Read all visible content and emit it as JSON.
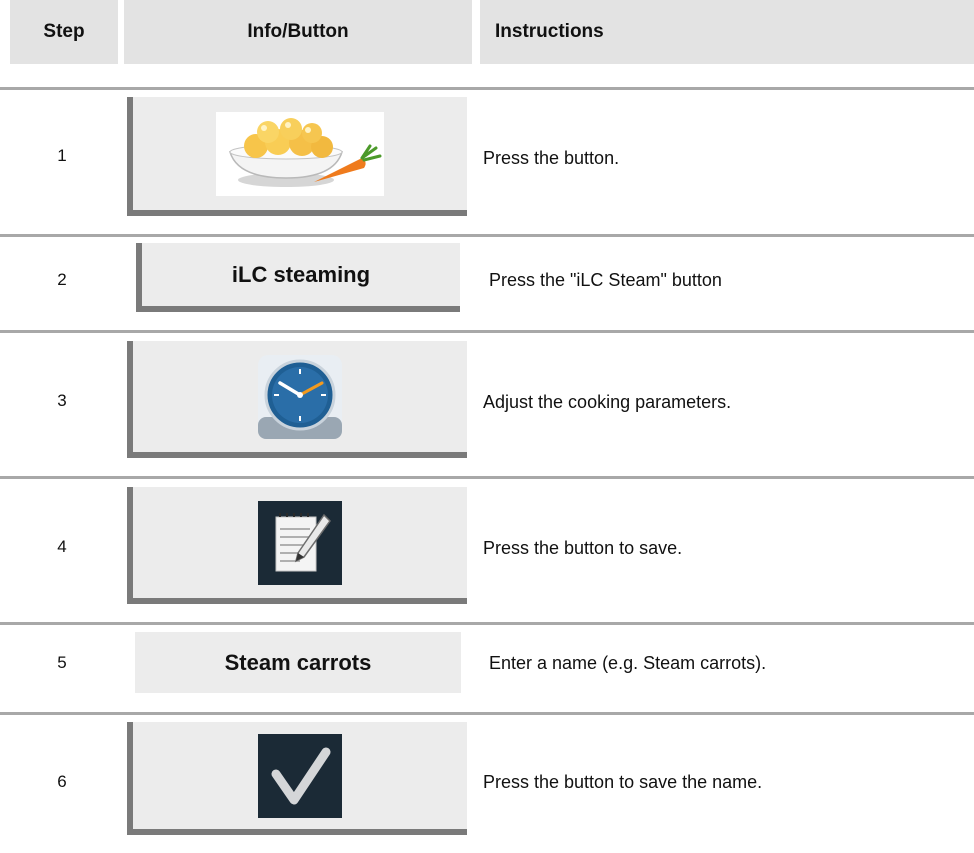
{
  "header": {
    "step": "Step",
    "info_button": "Info/Button",
    "instructions": "Instructions"
  },
  "steps": [
    {
      "number": "1",
      "icon": "dumplings-carrot-icon",
      "instruction": "Press the button."
    },
    {
      "number": "2",
      "button_label": "iLC steaming",
      "instruction": "Press the \"iLC Steam\" button"
    },
    {
      "number": "3",
      "icon": "clock-icon",
      "instruction": "Adjust the cooking parameters."
    },
    {
      "number": "4",
      "icon": "notepad-pencil-icon",
      "instruction": "Press the button to save."
    },
    {
      "number": "5",
      "button_label": "Steam carrots",
      "instruction": "Enter a name (e.g. Steam carrots)."
    },
    {
      "number": "6",
      "icon": "checkmark-icon",
      "instruction": "Press the button to save the name."
    }
  ],
  "colors": {
    "header_bg": "#e3e3e3",
    "divider": "#a8a8a8",
    "button_bg": "#ececec",
    "button_frame": "#7a7a7a",
    "icon_dark_bg": "#1b2a36",
    "clock_blue": "#1f5f94",
    "clock_hand": "#f39a1e"
  }
}
